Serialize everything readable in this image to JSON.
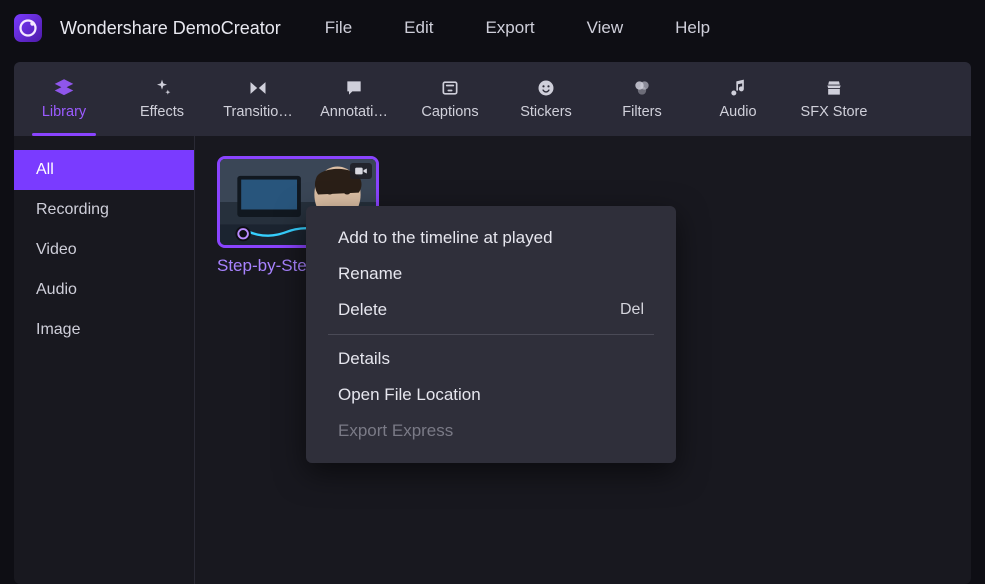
{
  "app": {
    "title": "Wondershare DemoCreator"
  },
  "menu": {
    "file": "File",
    "edit": "Edit",
    "export": "Export",
    "view": "View",
    "help": "Help"
  },
  "toolbar": {
    "library": "Library",
    "effects": "Effects",
    "transitions": "Transitio…",
    "annotations": "Annotati…",
    "captions": "Captions",
    "stickers": "Stickers",
    "filters": "Filters",
    "audio": "Audio",
    "sfx": "SFX Store"
  },
  "sidebar": {
    "all": "All",
    "recording": "Recording",
    "video": "Video",
    "audio": "Audio",
    "image": "Image"
  },
  "clip": {
    "title": "Step-by-Ste"
  },
  "context_menu": {
    "add_timeline": "Add to the timeline at played",
    "rename": "Rename",
    "delete": "Delete",
    "delete_short": "Del",
    "details": "Details",
    "open_location": "Open File Location",
    "export_express": "Export Express"
  }
}
